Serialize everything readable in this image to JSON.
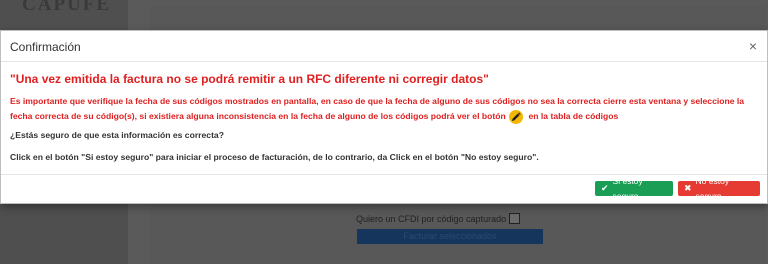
{
  "background": {
    "logo_text": "CAPUFE",
    "checkbox_label": "Quiero un CFDI por código capturado",
    "button_label": "Facturar seleccionados"
  },
  "modal": {
    "title": "Confirmación",
    "close_symbol": "×",
    "headline": "\"Una vez emitida la factura no se podrá remitir a un RFC diferente ni corregir datos\"",
    "warning_before_icon": "Es importante que verifique la fecha de sus códigos mostrados en pantalla, en caso de que la fecha de alguno de sus códigos no sea la correcta cierre esta ventana y seleccione la fecha correcta de su código(s), si existiera alguna inconsistencia en la fecha de alguno de los códigos podrá ver el botón",
    "warning_after_icon": "en la tabla de códigos",
    "question": "¿Estás seguro de que esta información es correcta?",
    "instruction": "Click en el botón \"Si estoy seguro\" para iniciar el proceso de facturación, de lo contrario, da Click en el botón \"No estoy seguro\".",
    "confirm_label": "Si estoy seguro",
    "confirm_icon": "check-icon",
    "cancel_label": "No estoy seguro",
    "cancel_icon": "x-icon",
    "edit_icon": "pencil-icon"
  },
  "colors": {
    "warning_text": "#e02020",
    "confirm_button": "#1a9d55",
    "cancel_button": "#e53b33",
    "edit_icon_bg": "#f2b705"
  }
}
